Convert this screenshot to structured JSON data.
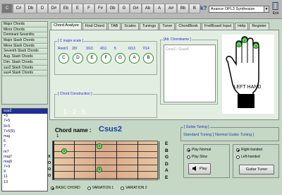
{
  "keys": [
    "C",
    "C#",
    "Db",
    "D",
    "D#",
    "Eb",
    "E",
    "F",
    "F#",
    "Gb",
    "G",
    "G#",
    "Ab",
    "A",
    "A#",
    "Bb",
    "B"
  ],
  "selected_key": "C",
  "synth": "Avance OPL3 Synthesize",
  "exit_label": "Exit",
  "chord_types": [
    "Major Chords",
    "Minor Chords",
    "Dominant Sevenths",
    "Major Slash Chords",
    "Minor Slash Chords",
    "Seventh Slash Chords",
    "Aug. Slash Chords",
    "Dim. Slash Chords",
    "sus2 Slash Chords",
    "sus4 Slash Chords"
  ],
  "chords": [
    "sus2",
    "+5",
    "7+5",
    "9+5",
    "7+5(9)",
    "maj",
    "6",
    "7",
    "m7",
    "maj7",
    "maj9",
    "7+9",
    "9",
    "11",
    "13"
  ],
  "selected_chord": "sus2",
  "tabs": [
    "Chord Analyze",
    "Find Chord",
    "TAB",
    "Scales",
    "Tunings",
    "Tuner",
    "ChordBook",
    "FretBoard Input",
    "Help",
    "Register"
  ],
  "active_tab": "Chord Analyze",
  "scale": {
    "title": "[ C major scale ]",
    "degrees": [
      "Root/1",
      "2/9",
      "3/10",
      "4/11",
      "5",
      "6/13",
      "7/14"
    ],
    "notes": [
      "C",
      "D",
      "E",
      "F",
      "G",
      "A",
      "B"
    ]
  },
  "construction": {
    "title": "[ Chord Construction ]",
    "value": "1 - 2 - 5"
  },
  "alt_chordname": {
    "title": "[Alt. Chordname ]",
    "value": "Csus2 / Gsus4"
  },
  "hand": {
    "label": "LEFT HAND",
    "finger_marks": [
      "1",
      "2",
      "3"
    ]
  },
  "chord_name_label": "Chord name :",
  "chord_name": "Csus2",
  "fret_position": "1",
  "strings": [
    "E",
    "B",
    "G",
    "D",
    "A",
    "E"
  ],
  "fret_string_marks": [
    "X",
    "O",
    "O",
    "O"
  ],
  "fingered_dots": [
    "1",
    "1",
    "3"
  ],
  "guitar_tuning": {
    "title": "[ Guitar Tuning ]",
    "value": "Standard Tuning [ Normal Guitar Tuning ]"
  },
  "play_options": [
    "Play Normal",
    "Play Slow"
  ],
  "play_selected": "Play Normal",
  "hand_options": [
    "Right-handed",
    "Left-handed"
  ],
  "hand_selected": "Right-handed",
  "play_button": "Play",
  "tuner_button": "Guitar Tuner",
  "variations": [
    "BASIC CHORD",
    "VARIATION 1",
    "VARIATION 2"
  ],
  "variation_selected": "BASIC CHORD",
  "colors": {
    "accent": "#1a3fa0",
    "background": "#c5d8c5",
    "selected": "#1c2f9c",
    "dot": "#6fe06f"
  }
}
